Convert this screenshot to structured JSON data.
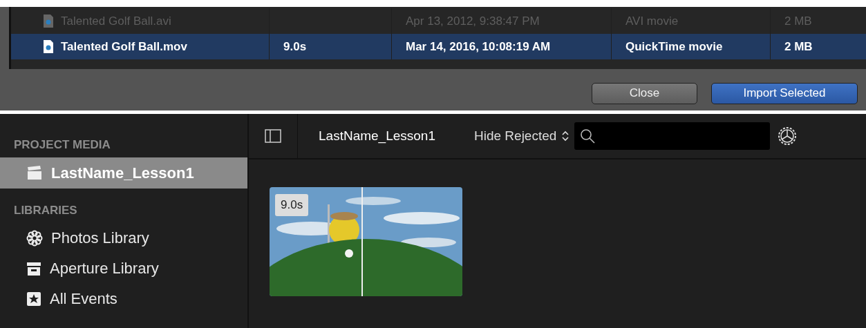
{
  "import_dialog": {
    "rows": [
      {
        "name": "Talented Golf Ball.avi",
        "date": "Apr 13, 2012, 9:38:47 PM",
        "type": "AVI movie",
        "size": "2 MB",
        "selected": false,
        "disabled": true
      },
      {
        "name": "Talented Golf Ball.mov",
        "duration": "9.0s",
        "date": "Mar 14, 2016, 10:08:19 AM",
        "type": "QuickTime movie",
        "size": "2 MB",
        "selected": true,
        "disabled": false
      }
    ],
    "buttons": [
      {
        "label": "Close",
        "kind": "default"
      },
      {
        "label": "Import Selected",
        "kind": "primary"
      }
    ]
  },
  "sidebar": {
    "sections": [
      {
        "title": "PROJECT MEDIA",
        "items": [
          {
            "label": "LastName_Lesson1",
            "kind": "project",
            "selected": true
          }
        ]
      },
      {
        "title": "LIBRARIES",
        "items": [
          {
            "label": "Photos Library",
            "kind": "photos",
            "selected": false
          },
          {
            "label": "Aperture Library",
            "kind": "aperture",
            "selected": false
          },
          {
            "label": "All Events",
            "kind": "events",
            "selected": false
          }
        ]
      }
    ]
  },
  "browser": {
    "title": "LastName_Lesson1",
    "filter": "Hide Rejected",
    "clips": [
      {
        "duration": "9.0s",
        "kind": "picture"
      }
    ]
  }
}
